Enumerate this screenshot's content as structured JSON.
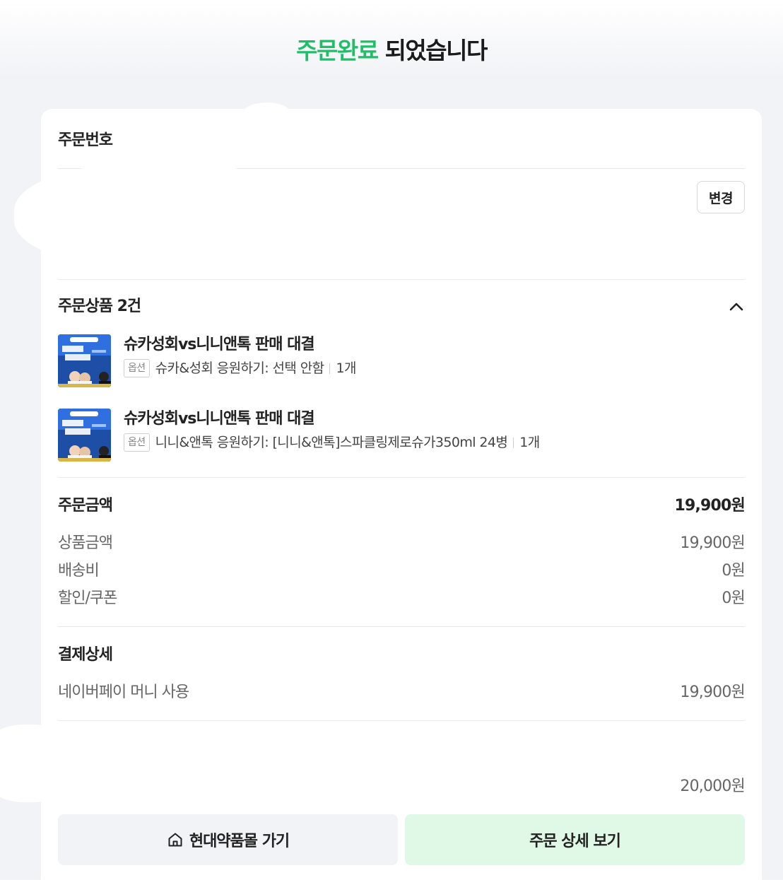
{
  "header": {
    "title_accent": "주문완료",
    "title_rest": " 되었습니다"
  },
  "order_number": {
    "label": "주문번호"
  },
  "address": {
    "change_label": "변경"
  },
  "items": {
    "title": "주문상품 2건",
    "collapse_icon": "chevron-up-icon",
    "list": [
      {
        "name": "슈카성회vs니니앤톡 판매 대결",
        "option_badge": "옵션",
        "option_text": "슈카&성회 응원하기: 선택 안함",
        "quantity": "1개"
      },
      {
        "name": "슈카성회vs니니앤톡 판매 대결",
        "option_badge": "옵션",
        "option_text": "니니&앤톡 응원하기: [니니&앤톡]스파클링제로슈가350ml 24병",
        "quantity": "1개"
      }
    ]
  },
  "amount": {
    "title": "주문금액",
    "total": "19,900원",
    "rows": [
      {
        "label": "상품금액",
        "value": "19,900원"
      },
      {
        "label": "배송비",
        "value": "0원"
      },
      {
        "label": "할인/쿠폰",
        "value": "0원"
      }
    ]
  },
  "payment": {
    "title": "결제상세",
    "method_label": "네이버페이 머니 사용",
    "method_value": "19,900원"
  },
  "extra": {
    "value": "20,000원"
  },
  "buttons": {
    "home_label": "현대약품몰 가기",
    "home_icon": "home-icon",
    "detail_label": "주문 상세 보기"
  },
  "colors": {
    "accent": "#1fbf6a",
    "detail_button_bg": "#dff9e6",
    "home_button_bg": "#f2f3f6",
    "thumb_bg": "#1d4fa6"
  }
}
